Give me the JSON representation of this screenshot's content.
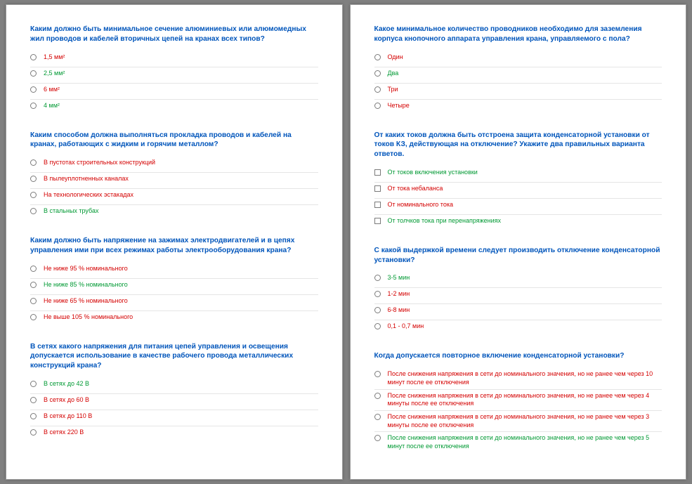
{
  "pages": [
    {
      "questions": [
        {
          "text": "Каким должно быть минимальное сечение алюминиевых или алюмомедных жил проводов и кабелей вторичных цепей на кранах всех типов?",
          "kind": "radio",
          "options": [
            {
              "label": "1,5 мм²",
              "color": "red"
            },
            {
              "label": "2,5 мм²",
              "color": "green"
            },
            {
              "label": "6 мм²",
              "color": "red"
            },
            {
              "label": "4 мм²",
              "color": "green"
            }
          ]
        },
        {
          "text": "Каким способом должна выполняться прокладка проводов и кабелей на кранах, работающих с жидким и горячим металлом?",
          "kind": "radio",
          "options": [
            {
              "label": "В пустотах строительных конструкций",
              "color": "red"
            },
            {
              "label": "В пылеуплотненных каналах",
              "color": "red"
            },
            {
              "label": "На технологических эстакадах",
              "color": "red"
            },
            {
              "label": "В стальных трубах",
              "color": "green"
            }
          ]
        },
        {
          "text": "Каким должно быть напряжение на зажимах электродвигателей и в цепях управления ими при всех режимах работы электрооборудования крана?",
          "kind": "radio",
          "options": [
            {
              "label": "Не ниже 95 % номинального",
              "color": "red"
            },
            {
              "label": "Не ниже 85 % номинального",
              "color": "green"
            },
            {
              "label": "Не ниже 65 % номинального",
              "color": "red"
            },
            {
              "label": "Не выше 105 % номинального",
              "color": "red"
            }
          ]
        },
        {
          "text": "В сетях какого напряжения для питания цепей управления и освещения допускается использование в качестве рабочего провода металлических конструкций крана?",
          "kind": "radio",
          "options": [
            {
              "label": "В сетях до 42 В",
              "color": "green"
            },
            {
              "label": "В сетях до 60 В",
              "color": "red"
            },
            {
              "label": "В сетях до 110 В",
              "color": "red"
            },
            {
              "label": "В сетях 220 В",
              "color": "red"
            }
          ]
        }
      ]
    },
    {
      "questions": [
        {
          "text": "Какое минимальное количество проводников необходимо для заземления корпуса кнопочного аппарата управления крана, управляемого с пола?",
          "kind": "radio",
          "options": [
            {
              "label": "Один",
              "color": "red"
            },
            {
              "label": "Два",
              "color": "green"
            },
            {
              "label": "Три",
              "color": "red"
            },
            {
              "label": "Четыре",
              "color": "red"
            }
          ]
        },
        {
          "text": "От каких токов должна быть отстроена защита конденсаторной установки от токов КЗ, действующая на отключение? Укажите два правильных варианта ответов.",
          "kind": "checkbox",
          "options": [
            {
              "label": "От токов включения установки",
              "color": "green"
            },
            {
              "label": "От тока небаланса",
              "color": "red"
            },
            {
              "label": "От номинального тока",
              "color": "red"
            },
            {
              "label": "От толчков тока при перенапряжениях",
              "color": "green"
            }
          ]
        },
        {
          "text": "С какой выдержкой времени следует производить отключение конденсаторной установки?",
          "kind": "radio",
          "options": [
            {
              "label": "3-5 мин",
              "color": "green"
            },
            {
              "label": "1-2 мин",
              "color": "red"
            },
            {
              "label": "6-8 мин",
              "color": "red"
            },
            {
              "label": "0,1 - 0,7 мин",
              "color": "red"
            }
          ]
        },
        {
          "text": "Когда допускается повторное включение конденсаторной установки?",
          "kind": "radio",
          "options": [
            {
              "label": "После снижения напряжения в сети до номинального значения, но не ранее чем через 10 минут после ее отключения",
              "color": "red"
            },
            {
              "label": "После снижения напряжения в сети до номинального значения, но не ранее чем через 4 минуты после ее отключения",
              "color": "red"
            },
            {
              "label": "После снижения напряжения в сети до номинального значения, но не ранее чем через 3 минуты после ее отключения",
              "color": "red"
            },
            {
              "label": "После снижения напряжения в сети до номинального значения, но не ранее чем через 5 минут после ее отключения",
              "color": "green"
            }
          ]
        }
      ]
    }
  ]
}
